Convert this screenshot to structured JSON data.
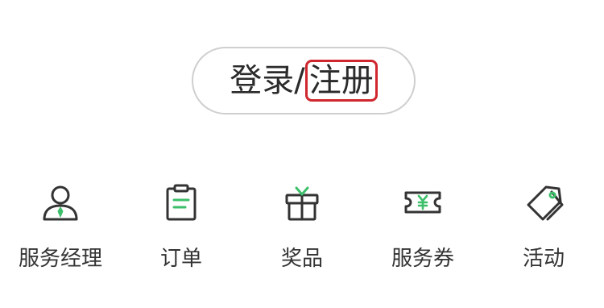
{
  "login": {
    "login_label": "登录/",
    "register_label": "注册",
    "highlight_color": "#d0272e"
  },
  "menu": {
    "items": [
      {
        "label": "服务经理",
        "icon": "manager-icon"
      },
      {
        "label": "订单",
        "icon": "clipboard-icon"
      },
      {
        "label": "奖品",
        "icon": "gift-icon"
      },
      {
        "label": "服务券",
        "icon": "coupon-icon"
      },
      {
        "label": "活动",
        "icon": "tag-icon"
      }
    ],
    "icon_color": "#333333",
    "accent_color": "#3dbf6a"
  }
}
